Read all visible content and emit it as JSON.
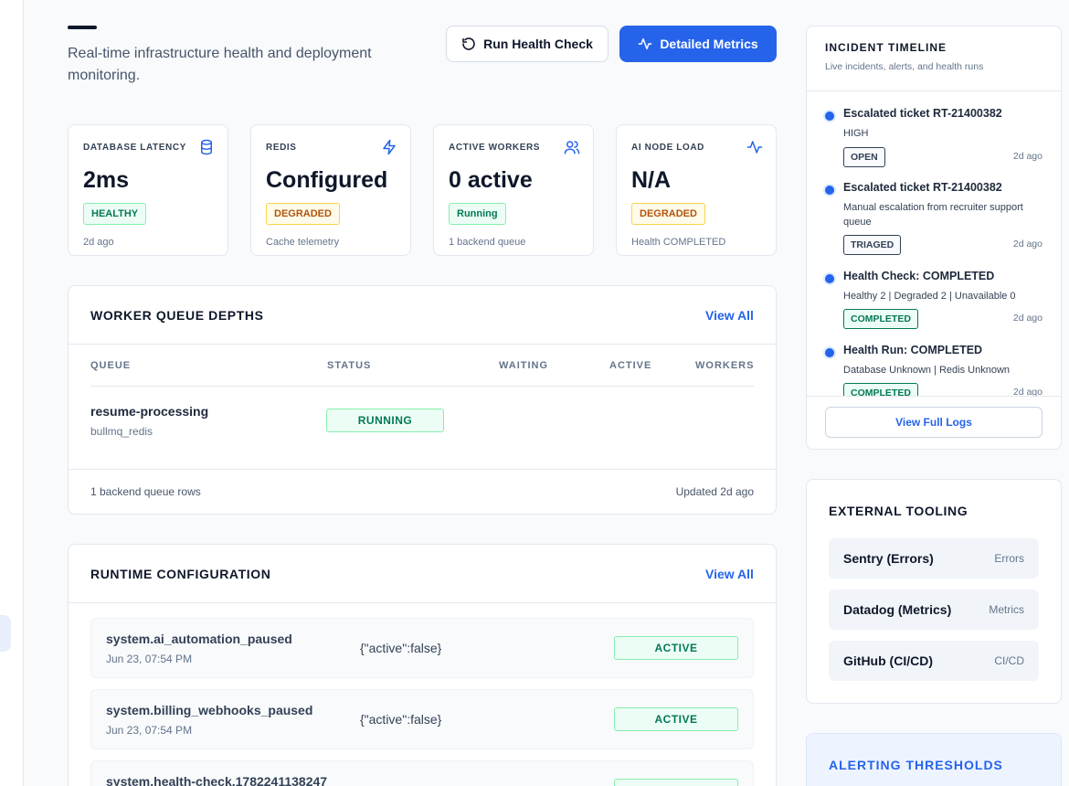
{
  "header": {
    "subtitle": "Real-time infrastructure health and deployment monitoring.",
    "run_health_check_label": "Run Health Check",
    "detailed_metrics_label": "Detailed Metrics"
  },
  "metrics": [
    {
      "label": "DATABASE LATENCY",
      "icon": "database-icon",
      "value": "2ms",
      "badge": "HEALTHY",
      "foot": "2d ago"
    },
    {
      "label": "REDIS",
      "icon": "lightning-icon",
      "value": "Configured",
      "badge": "DEGRADED",
      "foot": "Cache telemetry"
    },
    {
      "label": "ACTIVE WORKERS",
      "icon": "users-icon",
      "value": "0 active",
      "badge": "Running",
      "foot": "1 backend queue"
    },
    {
      "label": "AI NODE LOAD",
      "icon": "activity-icon",
      "value": "N/A",
      "badge": "DEGRADED",
      "foot": "Health COMPLETED"
    }
  ],
  "queue": {
    "title": "WORKER QUEUE DEPTHS",
    "view_all": "View All",
    "columns": [
      "QUEUE",
      "STATUS",
      "WAITING",
      "ACTIVE",
      "WORKERS"
    ],
    "rows": [
      {
        "name": "resume-processing",
        "sub": "bullmq_redis",
        "status": "RUNNING"
      }
    ],
    "footer_left": "1 backend queue rows",
    "footer_right": "Updated 2d ago"
  },
  "runtime": {
    "title": "RUNTIME CONFIGURATION",
    "view_all": "View All",
    "rows": [
      {
        "key": "system.ai_automation_paused",
        "time": "Jun 23, 07:54 PM",
        "value": "{\"active\":false}",
        "status": "ACTIVE"
      },
      {
        "key": "system.billing_webhooks_paused",
        "time": "Jun 23, 07:54 PM",
        "value": "{\"active\":false}",
        "status": "ACTIVE"
      },
      {
        "key": "system.health-check.1782241138247",
        "time": "",
        "value": "",
        "status": ""
      }
    ]
  },
  "timeline": {
    "title": "INCIDENT TIMELINE",
    "subtitle": "Live incidents, alerts, and health runs",
    "items": [
      {
        "title": "Escalated ticket RT-21400382",
        "desc": "HIGH",
        "badge": "OPEN",
        "time": "2d ago"
      },
      {
        "title": "Escalated ticket RT-21400382",
        "desc": "Manual escalation from recruiter support queue",
        "badge": "TRIAGED",
        "time": "2d ago"
      },
      {
        "title": "Health Check: COMPLETED",
        "desc": "Healthy 2 | Degraded 2 | Unavailable 0",
        "badge": "COMPLETED",
        "time": "2d ago"
      },
      {
        "title": "Health Run: COMPLETED",
        "desc": "Database Unknown | Redis Unknown",
        "badge": "COMPLETED",
        "time": "2d ago"
      }
    ],
    "view_logs": "View Full Logs"
  },
  "tooling": {
    "title": "EXTERNAL TOOLING",
    "items": [
      {
        "name": "Sentry (Errors)",
        "tag": "Errors"
      },
      {
        "name": "Datadog (Metrics)",
        "tag": "Metrics"
      },
      {
        "name": "GitHub (CI/CD)",
        "tag": "CI/CD"
      }
    ]
  },
  "alerting": {
    "title": "ALERTING THRESHOLDS"
  },
  "colors": {
    "primary": "#2563eb",
    "healthy": "#047857",
    "degraded": "#b45309"
  }
}
